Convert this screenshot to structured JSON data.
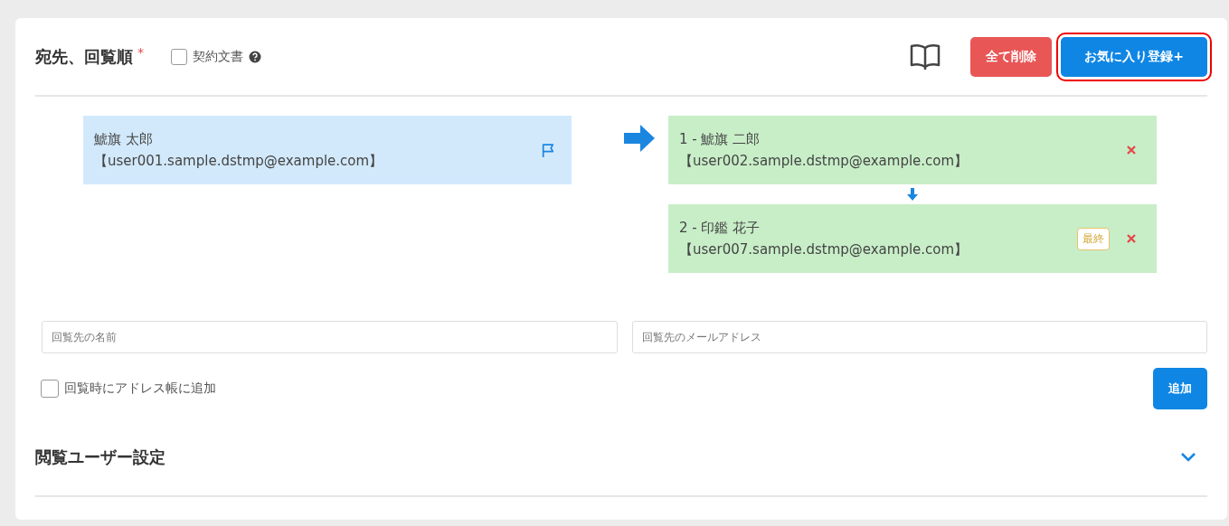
{
  "header": {
    "title": "宛先、回覧順",
    "required_mark": "*",
    "contract_checkbox": {
      "label": "契約文書",
      "checked": false
    }
  },
  "buttons": [
    {
      "kind": "danger",
      "label": "全て削除",
      "highlighted": false
    },
    {
      "kind": "primary",
      "label": "お気に入り登録+",
      "highlighted": true
    }
  ],
  "sender": {
    "name": "鯱旗 太郎",
    "email": "【user001.sample.dstmp@example.com】"
  },
  "recipients": [
    {
      "label": "1 - 鯱旗 二郎",
      "email": "【user002.sample.dstmp@example.com】",
      "final": false
    },
    {
      "label": "2 - 印鑑 花子",
      "email": "【user007.sample.dstmp@example.com】",
      "final": true,
      "final_label": "最終"
    }
  ],
  "form": {
    "name_placeholder": "回覧先の名前",
    "email_placeholder": "回覧先のメールアドレス",
    "address_book": {
      "label": "回覧時にアドレス帳に追加",
      "checked": false
    },
    "add_button": "追加"
  },
  "section": {
    "title": "閲覧ユーザー設定",
    "expanded": false
  }
}
